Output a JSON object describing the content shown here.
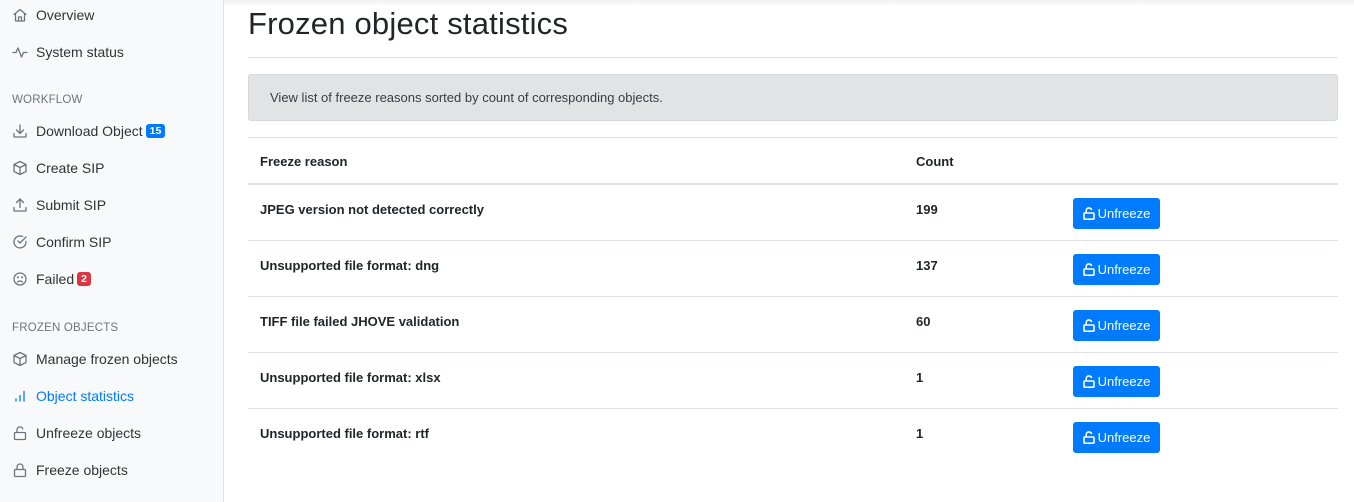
{
  "sidebar": {
    "top_items": [
      {
        "label": "Overview",
        "icon": "home-icon"
      },
      {
        "label": "System status",
        "icon": "activity-icon"
      }
    ],
    "sections": [
      {
        "heading": "WORKFLOW",
        "items": [
          {
            "label": "Download Object",
            "icon": "download-icon",
            "badge": "15",
            "badge_color": "#007bff"
          },
          {
            "label": "Create SIP",
            "icon": "package-icon"
          },
          {
            "label": "Submit SIP",
            "icon": "upload-icon"
          },
          {
            "label": "Confirm SIP",
            "icon": "check-circle-icon"
          },
          {
            "label": "Failed",
            "icon": "frown-icon",
            "badge": "2",
            "badge_color": "#dc3545"
          }
        ]
      },
      {
        "heading": "FROZEN OBJECTS",
        "items": [
          {
            "label": "Manage frozen objects",
            "icon": "package-icon"
          },
          {
            "label": "Object statistics",
            "icon": "bar-chart-icon",
            "active": true
          },
          {
            "label": "Unfreeze objects",
            "icon": "unlock-icon"
          },
          {
            "label": "Freeze objects",
            "icon": "lock-icon"
          }
        ]
      }
    ]
  },
  "main": {
    "title": "Frozen object statistics",
    "info": "View list of freeze reasons sorted by count of corresponding objects.",
    "table": {
      "columns": [
        "Freeze reason",
        "Count",
        ""
      ],
      "rows": [
        {
          "reason": "JPEG version not detected correctly",
          "count": "199",
          "action": "Unfreeze"
        },
        {
          "reason": "Unsupported file format: dng",
          "count": "137",
          "action": "Unfreeze"
        },
        {
          "reason": "TIFF file failed JHOVE validation",
          "count": "60",
          "action": "Unfreeze"
        },
        {
          "reason": "Unsupported file format: xlsx",
          "count": "1",
          "action": "Unfreeze"
        },
        {
          "reason": "Unsupported file format: rtf",
          "count": "1",
          "action": "Unfreeze"
        }
      ]
    }
  },
  "colors": {
    "accent": "#007bff",
    "danger": "#dc3545",
    "info_bg": "#e2e3e5",
    "sidebar_bg": "#f8f9fa"
  }
}
